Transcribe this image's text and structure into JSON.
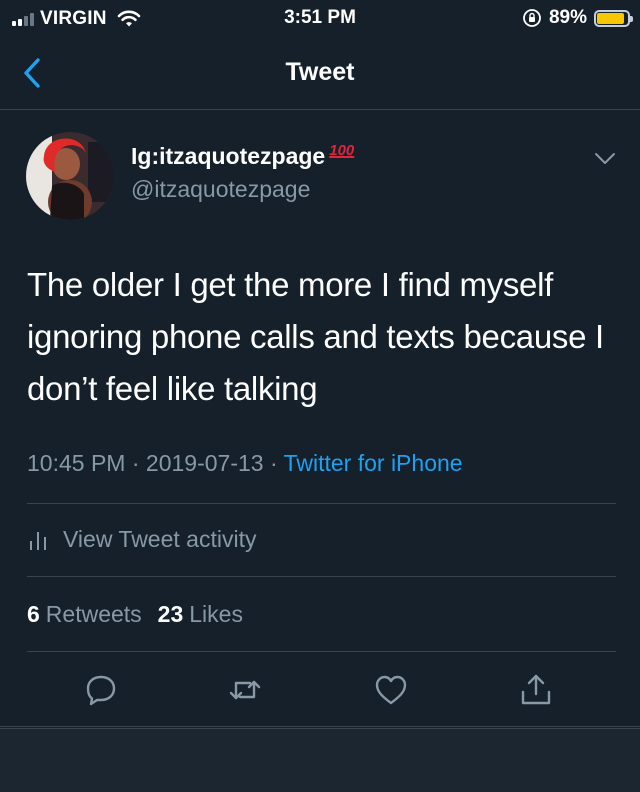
{
  "status_bar": {
    "carrier": "VIRGIN",
    "time": "3:51 PM",
    "battery_percent": "89%",
    "battery_level": 0.89,
    "battery_color": "#f7c800"
  },
  "nav": {
    "title": "Tweet"
  },
  "author": {
    "name": "Ig:itzaquotezpage",
    "emoji": "100",
    "handle": "@itzaquotezpage"
  },
  "tweet": {
    "text": "The older I get the more I find myself ignoring phone calls and texts because I don’t feel like talking",
    "time": "10:45 PM",
    "date": "2019-07-13",
    "source": "Twitter for iPhone"
  },
  "activity_label": "View Tweet activity",
  "stats": {
    "retweets_count": "6",
    "retweets_label": "Retweets",
    "likes_count": "23",
    "likes_label": "Likes"
  },
  "icons": [
    "signal-icon",
    "wifi-icon",
    "rotation-lock-icon",
    "battery-icon",
    "back-chevron-icon",
    "chevron-down-icon",
    "bar-chart-icon",
    "reply-icon",
    "retweet-icon",
    "like-icon",
    "share-icon"
  ],
  "colors": {
    "background": "#15202b",
    "accent": "#1da1f2",
    "secondary_text": "#8899a6",
    "divider": "#38444d"
  }
}
